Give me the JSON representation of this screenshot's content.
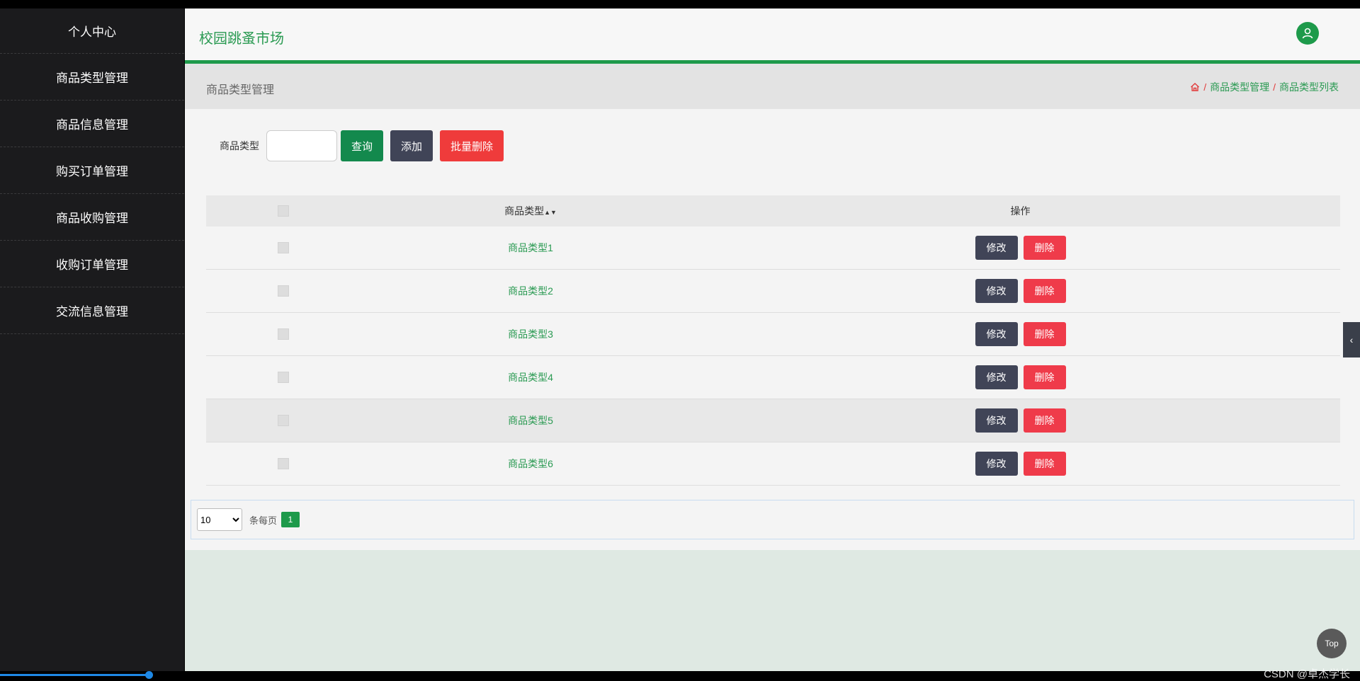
{
  "sidebar": {
    "items": [
      {
        "label": "个人中心"
      },
      {
        "label": "商品类型管理"
      },
      {
        "label": "商品信息管理"
      },
      {
        "label": "购买订单管理"
      },
      {
        "label": "商品收购管理"
      },
      {
        "label": "收购订单管理"
      },
      {
        "label": "交流信息管理"
      }
    ]
  },
  "header": {
    "title": "校园跳蚤市场",
    "avatar_icon": "user-icon"
  },
  "subheader": {
    "title": "商品类型管理",
    "breadcrumb": [
      "商品类型管理",
      "商品类型列表"
    ],
    "home_icon": "home-icon"
  },
  "search": {
    "label": "商品类型",
    "input_value": "",
    "query_label": "查询",
    "add_label": "添加",
    "batch_delete_label": "批量删除"
  },
  "table": {
    "headers": {
      "type": "商品类型",
      "sort_icon": "sort-icon",
      "op": "操作"
    },
    "rows": [
      {
        "type": "商品类型1",
        "edit": "修改",
        "delete": "删除"
      },
      {
        "type": "商品类型2",
        "edit": "修改",
        "delete": "删除"
      },
      {
        "type": "商品类型3",
        "edit": "修改",
        "delete": "删除"
      },
      {
        "type": "商品类型4",
        "edit": "修改",
        "delete": "删除"
      },
      {
        "type": "商品类型5",
        "edit": "修改",
        "delete": "删除"
      },
      {
        "type": "商品类型6",
        "edit": "修改",
        "delete": "删除"
      }
    ]
  },
  "pager": {
    "page_size": "10",
    "per_page_label": "条每页",
    "current_page": "1"
  },
  "floating": {
    "top_label": "Top",
    "toggle_icon": "chevron-left-icon"
  },
  "watermark": "CSDN @卓杰学长",
  "colors": {
    "accent": "#1e9a4b",
    "danger": "#ef3b3b",
    "dark": "#404457",
    "sidebar": "#1b1b1d"
  }
}
